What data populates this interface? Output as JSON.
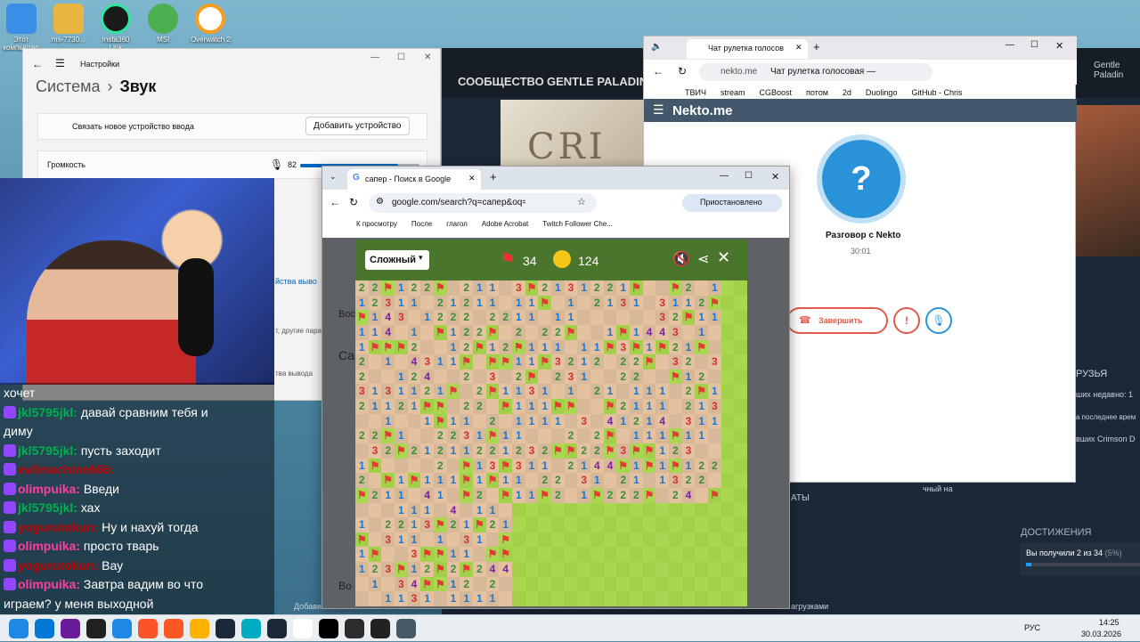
{
  "desktop": {
    "icons": [
      {
        "label": "Этот компьютер",
        "color": "#3a8ee6"
      },
      {
        "label": "ms-7730...",
        "color": "#e8b640"
      },
      {
        "label": "Insta360 Link",
        "color": "#1a1a1a"
      },
      {
        "label": "MSI",
        "color": "#4caf50"
      },
      {
        "label": "Overwatch 2",
        "color": "#f5f5f5"
      }
    ]
  },
  "settings": {
    "app_title": "Настройки",
    "crumb_parent": "Система",
    "crumb_sep": "›",
    "crumb_current": "Звук",
    "connect_label": "Связать новое устройство ввода",
    "add_device_btn": "Добавить устройство",
    "volume_label": "Громкость",
    "volume_value": "82",
    "volume_level": 0.82,
    "link_props": "йства выво",
    "other_params": "т, другие пара",
    "output_dev": "тва вывода"
  },
  "steam": {
    "nav": [
      "СООБЩЕСТВО",
      "GENTLE PALADIN"
    ],
    "game_title_art": "CRI",
    "user": "Gentle Paladin",
    "friends_label": "РУЗЬЯ",
    "recent_label": "ших недавно: 1",
    "last_time": "а последнее врем",
    "played": "вших Crimson D",
    "ach_header": "ДОСТИЖЕНИЯ",
    "ach_text": "Вы получили 2 из 34",
    "ach_pct": "(5%)",
    "ach_level": 0.05,
    "aty": "АТЫ",
    "net_label": "чный на",
    "downloads": "агрузками",
    "add_game": "Добавить",
    "friends_partial": "Друз"
  },
  "nekto": {
    "tab_title": "Чат рулетка голосов",
    "url": "nekto.me",
    "page_title": "Чат рулетка голосовая —",
    "bookmarks": [
      "ТВИЧ",
      "stream",
      "CGBoost",
      "потом",
      "2d",
      "Duolingo",
      "GitHub - Chris"
    ],
    "brand": "Nekto.me",
    "talk_title": "Разговор с Nekto",
    "timer": "30:01",
    "end_btn": "Завершить"
  },
  "chrome": {
    "tab_title": "сапер - Поиск в Google",
    "url": "google.com/search?q=сапер&oq=...",
    "paused": "Приостановлено",
    "bookmarks": [
      "К просмотру",
      "После",
      "глагол",
      "Adobe Acrobat",
      "Twitch Follower Che..."
    ],
    "side_word_1": "Вос",
    "side_word_2": "Сап",
    "side_word_3": "Во"
  },
  "minesweeper": {
    "difficulty": "Сложный",
    "flags": "34",
    "time": "124"
  },
  "chat": {
    "messages": [
      {
        "user": "",
        "text": "хочет",
        "ucolor": "#fff"
      },
      {
        "user": "jkl5795jkl:",
        "text": "давай сравним тебя и",
        "ucolor": "#00b050"
      },
      {
        "user": "",
        "text": "диму",
        "ucolor": "#fff"
      },
      {
        "user": "jkl5795jkl:",
        "text": "пусть заходит",
        "ucolor": "#00b050"
      },
      {
        "user": "evilmachine666:",
        "text": "",
        "ucolor": "#c00000"
      },
      {
        "user": "olimpuika:",
        "text": "Введи",
        "ucolor": "#ff3ea5"
      },
      {
        "user": "jkl5795jkl:",
        "text": "хах",
        "ucolor": "#00b050"
      },
      {
        "user": "yogurutokun:",
        "text": "Ну и нахуй тогда",
        "ucolor": "#c00000"
      },
      {
        "user": "olimpuika:",
        "text": "просто тварь",
        "ucolor": "#ff3ea5"
      },
      {
        "user": "yogurutokun:",
        "text": "Вау",
        "ucolor": "#c00000"
      },
      {
        "user": "olimpuika:",
        "text": "Завтра вадим во что",
        "ucolor": "#ff3ea5"
      },
      {
        "user": "",
        "text": "играем? у меня выходной",
        "ucolor": "#fff"
      }
    ]
  },
  "taskbar": {
    "lang": "РУС",
    "time": "14:25",
    "date": "30.03.2026"
  }
}
